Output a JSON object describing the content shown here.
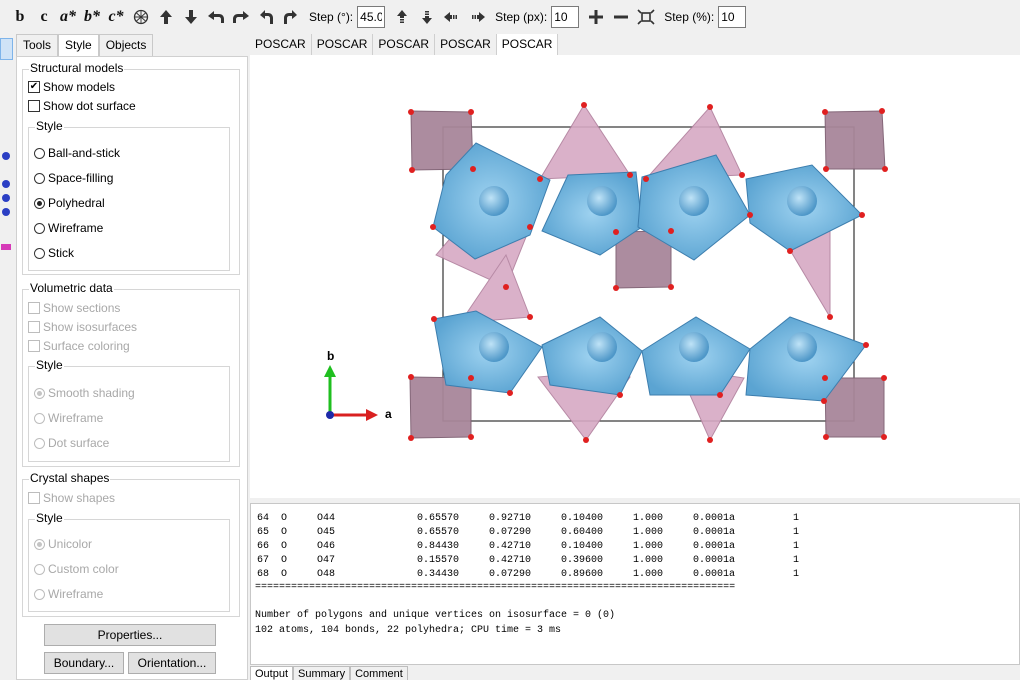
{
  "toolbar": {
    "axis_buttons": [
      "b",
      "c",
      "a*",
      "b*",
      "c*"
    ],
    "icons": [
      "polyhedron-view-icon",
      "rotate-up-icon",
      "rotate-down-icon",
      "rotate-left-icon",
      "rotate-right-icon",
      "rotate-ccw-icon",
      "rotate-cw-icon"
    ],
    "step_deg_label": "Step (°):",
    "step_deg_value": "45.0",
    "step_px_label": "Step (px):",
    "step_px_value": "10",
    "step_pct_label": "Step (%):",
    "step_pct_value": "10"
  },
  "panel": {
    "tabs": [
      "Tools",
      "Style",
      "Objects"
    ],
    "active_tab": "Style",
    "structural": {
      "title": "Structural models",
      "show_models": "Show models",
      "show_dot_surface": "Show dot surface",
      "style_title": "Style",
      "options": [
        "Ball-and-stick",
        "Space-filling",
        "Polyhedral",
        "Wireframe",
        "Stick"
      ],
      "selected": "Polyhedral"
    },
    "volumetric": {
      "title": "Volumetric data",
      "show_sections": "Show sections",
      "show_isosurfaces": "Show isosurfaces",
      "surface_coloring": "Surface coloring",
      "style_title": "Style",
      "options": [
        "Smooth shading",
        "Wireframe",
        "Dot surface"
      ]
    },
    "crystal": {
      "title": "Crystal shapes",
      "show_shapes": "Show shapes",
      "style_title": "Style",
      "options": [
        "Unicolor",
        "Custom color",
        "Wireframe"
      ]
    },
    "properties_btn": "Properties...",
    "boundary_btn": "Boundary...",
    "orientation_btn": "Orientation..."
  },
  "viewer": {
    "tabs": [
      "POSCAR",
      "POSCAR",
      "POSCAR",
      "POSCAR",
      "POSCAR"
    ],
    "axis_b": "b",
    "axis_a": "a",
    "colors": {
      "blue_poly": "#6fb3dc",
      "mauve_poly": "#a8869a",
      "pink_poly": "#d6a9c4",
      "oxygen": "#e02020"
    }
  },
  "output": {
    "rows": [
      [
        "64",
        "O",
        "O44",
        "0.65570",
        "0.92710",
        "0.10400",
        "1.000",
        "0.000",
        "1a",
        "1"
      ],
      [
        "65",
        "O",
        "O45",
        "0.65570",
        "0.07290",
        "0.60400",
        "1.000",
        "0.000",
        "1a",
        "1"
      ],
      [
        "66",
        "O",
        "O46",
        "0.84430",
        "0.42710",
        "0.10400",
        "1.000",
        "0.000",
        "1a",
        "1"
      ],
      [
        "67",
        "O",
        "O47",
        "0.15570",
        "0.42710",
        "0.39600",
        "1.000",
        "0.000",
        "1a",
        "1"
      ],
      [
        "68",
        "O",
        "O48",
        "0.34430",
        "0.07290",
        "0.89600",
        "1.000",
        "0.000",
        "1a",
        "1"
      ]
    ],
    "separator": "================================================================================",
    "line1": "Number of polygons and unique vertices on isosurface = 0 (0)",
    "line2": "102 atoms, 104 bonds, 22 polyhedra; CPU time = 3 ms",
    "tabs": [
      "Output",
      "Summary",
      "Comment"
    ]
  }
}
